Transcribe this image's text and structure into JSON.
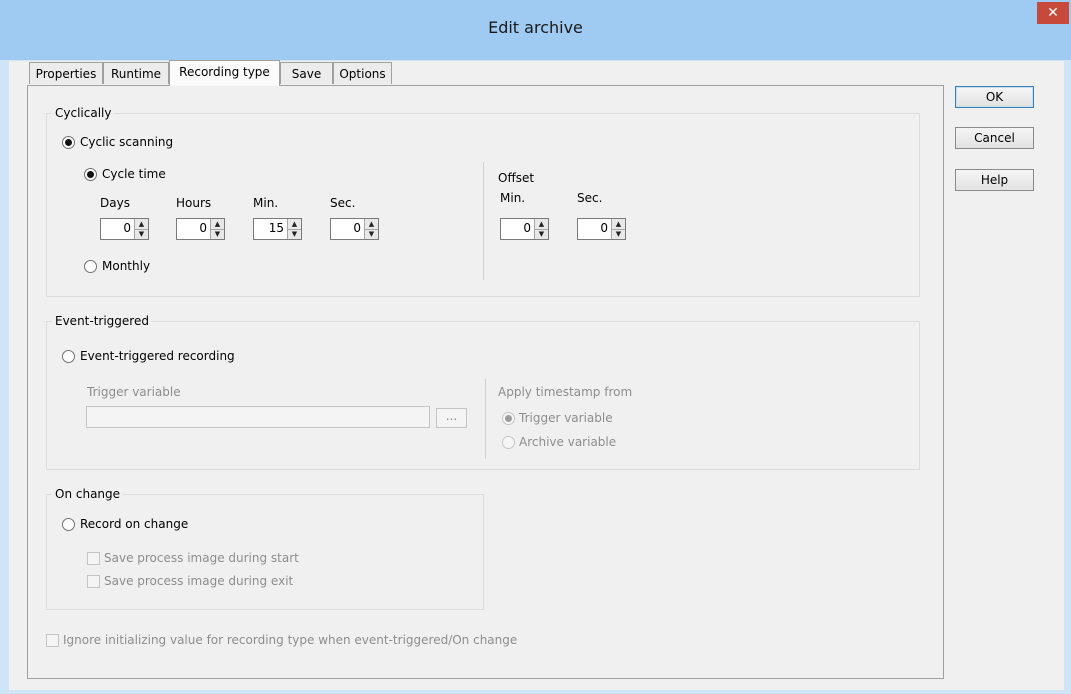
{
  "window": {
    "title": "Edit archive",
    "close_glyph": "✕"
  },
  "tabs": [
    {
      "label": "Properties"
    },
    {
      "label": "Runtime"
    },
    {
      "label": "Recording type"
    },
    {
      "label": "Save"
    },
    {
      "label": "Options"
    }
  ],
  "buttons": {
    "ok": "OK",
    "cancel": "Cancel",
    "help": "Help"
  },
  "cyclically": {
    "title": "Cyclically",
    "cyclic_scanning": "Cyclic scanning",
    "cycle_time": "Cycle time",
    "monthly": "Monthly",
    "fields": [
      {
        "label": "Days",
        "value": "0"
      },
      {
        "label": "Hours",
        "value": "0"
      },
      {
        "label": "Min.",
        "value": "15"
      },
      {
        "label": "Sec.",
        "value": "0"
      }
    ],
    "offset": {
      "title": "Offset",
      "fields": [
        {
          "label": "Min.",
          "value": "0"
        },
        {
          "label": "Sec.",
          "value": "0"
        }
      ]
    }
  },
  "event": {
    "title": "Event-triggered",
    "event_recording": "Event-triggered recording",
    "trigger_variable_label": "Trigger variable",
    "trigger_variable_value": "",
    "browse": "...",
    "apply_timestamp": "Apply timestamp from",
    "opt_trigger": "Trigger variable",
    "opt_archive": "Archive variable"
  },
  "onchange": {
    "title": "On change",
    "record": "Record on change",
    "save_start": "Save process image during start",
    "save_exit": "Save process image during exit"
  },
  "ignore_init": "Ignore initializing value for recording type when event-triggered/On change"
}
